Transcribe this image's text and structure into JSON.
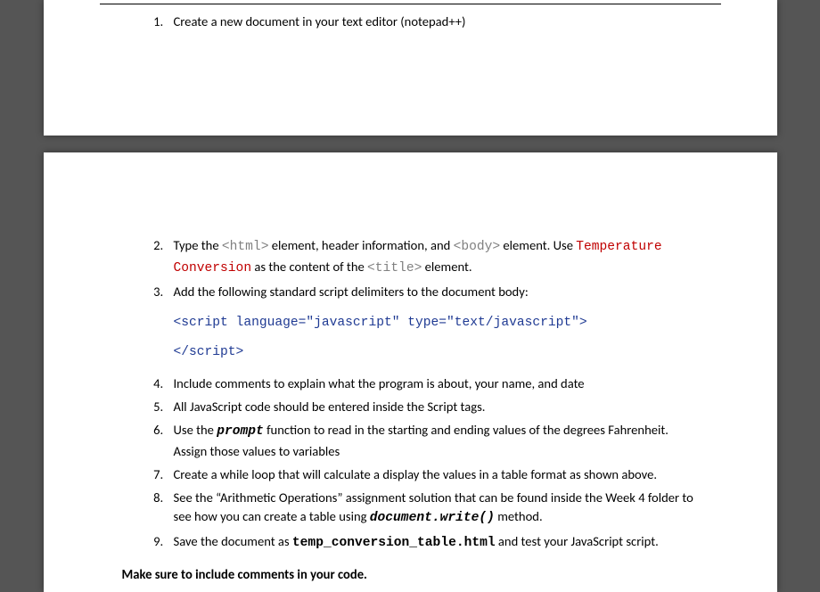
{
  "page1": {
    "items": [
      {
        "n": "1.",
        "text": "Create a new document in your text editor (notepad++)"
      }
    ]
  },
  "page2": {
    "item2": {
      "n": "2.",
      "t1": "Type the ",
      "c1": "<html>",
      "t2": " element, header information, and ",
      "c2": "<body>",
      "t3": " element. Use ",
      "red1": "Temperature Conversion",
      "t4": " as the content of the ",
      "c3": "<title>",
      "t5": " element."
    },
    "item3": {
      "n": "3.",
      "text": "Add the following standard script delimiters to the document body:"
    },
    "script_open": "<script language=\"javascript\" type=\"text/javascript\">",
    "script_close": "</script>",
    "item4": {
      "n": "4.",
      "text": "Include comments to explain what the program is about, your name, and date"
    },
    "item5": {
      "n": "5.",
      "text": "All JavaScript code should be entered inside the Script tags."
    },
    "item6": {
      "n": "6.",
      "t1": "Use the ",
      "c1": "prompt",
      "t2": " function to read in the starting and ending values of the degrees Fahrenheit. Assign those values to variables"
    },
    "item7": {
      "n": "7.",
      "text": "Create a while loop that will calculate a display the values in a table format as shown above."
    },
    "item8": {
      "n": "8.",
      "t1": "See the “Arithmetic Operations” assignment solution that can be found inside the Week 4 folder to see how you can create a table using ",
      "c1": "document.write()",
      "t2": " method."
    },
    "item9": {
      "n": "9.",
      "t1": "Save the document as ",
      "c1": "temp_conversion_table.html",
      "t2": " and test your JavaScript script."
    },
    "final": "Make sure to include comments in your code."
  }
}
